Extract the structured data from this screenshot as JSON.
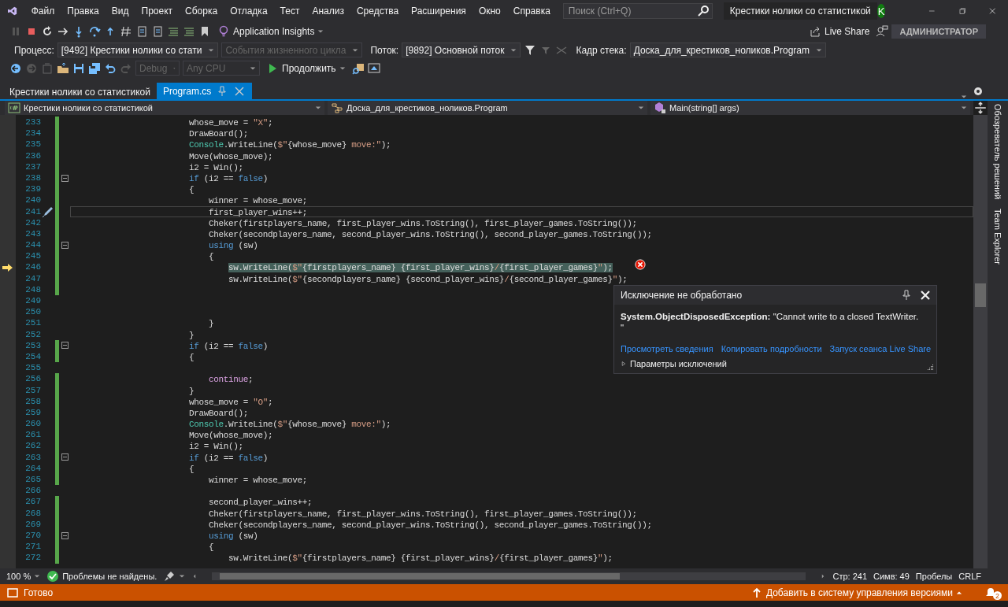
{
  "title_bar": {
    "menu": [
      "Файл",
      "Правка",
      "Вид",
      "Проект",
      "Сборка",
      "Отладка",
      "Тест",
      "Анализ",
      "Средства",
      "Расширения",
      "Окно",
      "Справка"
    ],
    "search": {
      "placeholder": "Поиск (Ctrl+Q)"
    },
    "solution_name": "Крестики нолики со статистикой",
    "avatar": "K"
  },
  "toolbar": {
    "application_insights": "Application Insights",
    "live_share": "Live Share",
    "user_badge": "АДМИНИСТРАТОР"
  },
  "debug_location": [
    {
      "kind": "label",
      "text": "Процесс:"
    },
    {
      "kind": "dropdown",
      "text": "[9492] Крестики нолики со стати",
      "disabled": false
    },
    {
      "kind": "dropdown",
      "text": "События жизненного цикла",
      "disabled": true
    },
    {
      "kind": "label",
      "text": "Поток:"
    },
    {
      "kind": "dropdown",
      "text": "[9892] Основной поток",
      "disabled": false
    },
    {
      "kind": "label",
      "text": "Кадр стека:"
    },
    {
      "kind": "dropdown",
      "text": "Доска_для_крестиков_ноликов.Program",
      "disabled": false
    }
  ],
  "standard_toolbar": {
    "configs": [
      {
        "text": "Debug",
        "disabled": true
      },
      {
        "text": "Any CPU",
        "disabled": true
      }
    ],
    "continue_button": "Продолжить"
  },
  "tabs": [
    {
      "label": "Крестики нолики со статистикой",
      "selected": false
    },
    {
      "label": "Program.cs",
      "selected": true
    }
  ],
  "navigation": [
    "Крестики нолики со статистикой",
    "Доска_для_крестиков_ноликов.Program",
    "Main(string[] args)"
  ],
  "code_lines": [
    {
      "number": "233",
      "changed": true,
      "foldable": false,
      "cursor": false,
      "highlighted": false,
      "tokens": [
        {
          "kind": "p",
          "text": "                        whose_move = "
        },
        {
          "kind": "st",
          "text": "\"X\""
        },
        {
          "kind": "p",
          "text": ";"
        }
      ]
    },
    {
      "number": "234",
      "changed": true,
      "foldable": false,
      "cursor": false,
      "highlighted": false,
      "tokens": [
        {
          "kind": "p",
          "text": "                        DrawBoard();"
        }
      ]
    },
    {
      "number": "235",
      "changed": true,
      "foldable": false,
      "cursor": false,
      "highlighted": false,
      "tokens": [
        {
          "kind": "ty",
          "text": "                        Console"
        },
        {
          "kind": "p",
          "text": ".WriteLine("
        },
        {
          "kind": "st",
          "text": "$\""
        },
        {
          "kind": "p",
          "text": "{whose_move}"
        },
        {
          "kind": "st",
          "text": " move:\""
        },
        {
          "kind": "p",
          "text": ");"
        }
      ]
    },
    {
      "number": "236",
      "changed": true,
      "foldable": false,
      "cursor": false,
      "highlighted": false,
      "tokens": [
        {
          "kind": "p",
          "text": "                        Move(whose_move);"
        }
      ]
    },
    {
      "number": "237",
      "changed": true,
      "foldable": false,
      "cursor": false,
      "highlighted": false,
      "tokens": [
        {
          "kind": "p",
          "text": "                        i2 = Win();"
        }
      ]
    },
    {
      "number": "238",
      "changed": true,
      "foldable": true,
      "cursor": false,
      "highlighted": false,
      "tokens": [
        {
          "kind": "kw",
          "text": "                        if"
        },
        {
          "kind": "p",
          "text": " (i2 == "
        },
        {
          "kind": "kw",
          "text": "false"
        },
        {
          "kind": "p",
          "text": ")"
        }
      ]
    },
    {
      "number": "239",
      "changed": true,
      "foldable": false,
      "cursor": false,
      "highlighted": false,
      "tokens": [
        {
          "kind": "p",
          "text": "                        {"
        }
      ]
    },
    {
      "number": "240",
      "changed": true,
      "foldable": false,
      "cursor": false,
      "highlighted": false,
      "tokens": [
        {
          "kind": "p",
          "text": "                            winner = whose_move;"
        }
      ]
    },
    {
      "number": "241",
      "changed": true,
      "foldable": false,
      "cursor": true,
      "highlighted": false,
      "tokens": [
        {
          "kind": "p",
          "text": "                            first_player_wins++;"
        }
      ]
    },
    {
      "number": "242",
      "changed": true,
      "foldable": false,
      "cursor": false,
      "highlighted": false,
      "tokens": [
        {
          "kind": "p",
          "text": "                            Cheker(firstplayers_name, first_player_wins.ToString(), first_player_games.ToString());"
        }
      ]
    },
    {
      "number": "243",
      "changed": true,
      "foldable": false,
      "cursor": false,
      "highlighted": false,
      "tokens": [
        {
          "kind": "p",
          "text": "                            Cheker(secondplayers_name, second_player_wins.ToString(), second_player_games.ToString());"
        }
      ]
    },
    {
      "number": "244",
      "changed": true,
      "foldable": true,
      "cursor": false,
      "highlighted": false,
      "tokens": [
        {
          "kind": "kw",
          "text": "                            using"
        },
        {
          "kind": "p",
          "text": " (sw)"
        }
      ]
    },
    {
      "number": "245",
      "changed": true,
      "foldable": false,
      "cursor": false,
      "highlighted": false,
      "tokens": [
        {
          "kind": "p",
          "text": "                            {"
        }
      ]
    },
    {
      "number": "246",
      "changed": true,
      "foldable": false,
      "cursor": false,
      "highlighted": true,
      "tokens": [
        {
          "kind": "p",
          "text": "                                sw.WriteLine("
        },
        {
          "kind": "st",
          "text": "$\""
        },
        {
          "kind": "p",
          "text": "{firstplayers_name} {first_player_wins}"
        },
        {
          "kind": "st",
          "text": "/"
        },
        {
          "kind": "p",
          "text": "{first_player_games}"
        },
        {
          "kind": "st",
          "text": "\""
        },
        {
          "kind": "p",
          "text": ");"
        }
      ]
    },
    {
      "number": "247",
      "changed": true,
      "foldable": false,
      "cursor": false,
      "highlighted": false,
      "tokens": [
        {
          "kind": "p",
          "text": "                                sw.WriteLine("
        },
        {
          "kind": "st",
          "text": "$\""
        },
        {
          "kind": "p",
          "text": "{secondplayers_name} {second_player_wins}"
        },
        {
          "kind": "st",
          "text": "/"
        },
        {
          "kind": "p",
          "text": "{second_player_games}"
        },
        {
          "kind": "st",
          "text": "\""
        },
        {
          "kind": "p",
          "text": ");"
        }
      ]
    },
    {
      "number": "248",
      "changed": true,
      "foldable": false,
      "cursor": false,
      "highlighted": false
    },
    {
      "number": "249",
      "changed": false,
      "foldable": false,
      "cursor": false,
      "highlighted": false
    },
    {
      "number": "250",
      "changed": false,
      "foldable": false,
      "cursor": false,
      "highlighted": false
    },
    {
      "number": "251",
      "changed": false,
      "foldable": false,
      "cursor": false,
      "highlighted": false,
      "tokens": [
        {
          "kind": "p",
          "text": "                            }"
        }
      ]
    },
    {
      "number": "252",
      "changed": false,
      "foldable": false,
      "cursor": false,
      "highlighted": false,
      "tokens": [
        {
          "kind": "p",
          "text": "                        }"
        }
      ]
    },
    {
      "number": "253",
      "changed": true,
      "foldable": true,
      "cursor": false,
      "highlighted": false,
      "tokens": [
        {
          "kind": "kw",
          "text": "                        if"
        },
        {
          "kind": "p",
          "text": " (i2 == "
        },
        {
          "kind": "kw",
          "text": "false"
        },
        {
          "kind": "p",
          "text": ")"
        }
      ]
    },
    {
      "number": "254",
      "changed": true,
      "foldable": false,
      "cursor": false,
      "highlighted": false,
      "tokens": [
        {
          "kind": "p",
          "text": "                        {"
        }
      ]
    },
    {
      "number": "255",
      "changed": false,
      "foldable": false,
      "cursor": false,
      "highlighted": false
    },
    {
      "number": "256",
      "changed": true,
      "foldable": false,
      "cursor": false,
      "highlighted": false,
      "tokens": [
        {
          "kind": "ct",
          "text": "                            continue"
        },
        {
          "kind": "p",
          "text": ";"
        }
      ]
    },
    {
      "number": "257",
      "changed": true,
      "foldable": false,
      "cursor": false,
      "highlighted": false,
      "tokens": [
        {
          "kind": "p",
          "text": "                        }"
        }
      ]
    },
    {
      "number": "258",
      "changed": true,
      "foldable": false,
      "cursor": false,
      "highlighted": false,
      "tokens": [
        {
          "kind": "p",
          "text": "                        whose_move = "
        },
        {
          "kind": "st",
          "text": "\"O\""
        },
        {
          "kind": "p",
          "text": ";"
        }
      ]
    },
    {
      "number": "259",
      "changed": true,
      "foldable": false,
      "cursor": false,
      "highlighted": false,
      "tokens": [
        {
          "kind": "p",
          "text": "                        DrawBoard();"
        }
      ]
    },
    {
      "number": "260",
      "changed": true,
      "foldable": false,
      "cursor": false,
      "highlighted": false,
      "tokens": [
        {
          "kind": "ty",
          "text": "                        Console"
        },
        {
          "kind": "p",
          "text": ".WriteLine("
        },
        {
          "kind": "st",
          "text": "$\""
        },
        {
          "kind": "p",
          "text": "{whose_move}"
        },
        {
          "kind": "st",
          "text": " move:\""
        },
        {
          "kind": "p",
          "text": ");"
        }
      ]
    },
    {
      "number": "261",
      "changed": true,
      "foldable": false,
      "cursor": false,
      "highlighted": false,
      "tokens": [
        {
          "kind": "p",
          "text": "                        Move(whose_move);"
        }
      ]
    },
    {
      "number": "262",
      "changed": true,
      "foldable": false,
      "cursor": false,
      "highlighted": false,
      "tokens": [
        {
          "kind": "p",
          "text": "                        i2 = Win();"
        }
      ]
    },
    {
      "number": "263",
      "changed": true,
      "foldable": true,
      "cursor": false,
      "highlighted": false,
      "tokens": [
        {
          "kind": "kw",
          "text": "                        if"
        },
        {
          "kind": "p",
          "text": " (i2 == "
        },
        {
          "kind": "kw",
          "text": "false"
        },
        {
          "kind": "p",
          "text": ")"
        }
      ]
    },
    {
      "number": "264",
      "changed": true,
      "foldable": false,
      "cursor": false,
      "highlighted": false,
      "tokens": [
        {
          "kind": "p",
          "text": "                        {"
        }
      ]
    },
    {
      "number": "265",
      "changed": true,
      "foldable": false,
      "cursor": false,
      "highlighted": false,
      "tokens": [
        {
          "kind": "p",
          "text": "                            winner = whose_move;"
        }
      ]
    },
    {
      "number": "266",
      "changed": false,
      "foldable": false,
      "cursor": false,
      "highlighted": false
    },
    {
      "number": "267",
      "changed": true,
      "foldable": false,
      "cursor": false,
      "highlighted": false,
      "tokens": [
        {
          "kind": "p",
          "text": "                            second_player_wins++;"
        }
      ]
    },
    {
      "number": "268",
      "changed": true,
      "foldable": false,
      "cursor": false,
      "highlighted": false,
      "tokens": [
        {
          "kind": "p",
          "text": "                            Cheker(firstplayers_name, first_player_wins.ToString(), first_player_games.ToString());"
        }
      ]
    },
    {
      "number": "269",
      "changed": true,
      "foldable": false,
      "cursor": false,
      "highlighted": false,
      "tokens": [
        {
          "kind": "p",
          "text": "                            Cheker(secondplayers_name, second_player_wins.ToString(), second_player_games.ToString());"
        }
      ]
    },
    {
      "number": "270",
      "changed": true,
      "foldable": true,
      "cursor": false,
      "highlighted": false,
      "tokens": [
        {
          "kind": "kw",
          "text": "                            using"
        },
        {
          "kind": "p",
          "text": " (sw)"
        }
      ]
    },
    {
      "number": "271",
      "changed": true,
      "foldable": false,
      "cursor": false,
      "highlighted": false,
      "tokens": [
        {
          "kind": "p",
          "text": "                            {"
        }
      ]
    },
    {
      "number": "272",
      "changed": true,
      "foldable": false,
      "cursor": false,
      "highlighted": false,
      "tokens": [
        {
          "kind": "p",
          "text": "                                sw.WriteLine("
        },
        {
          "kind": "st",
          "text": "$\""
        },
        {
          "kind": "p",
          "text": "{firstplayers_name} {first_player_wins}"
        },
        {
          "kind": "st",
          "text": "/"
        },
        {
          "kind": "p",
          "text": "{first_player_games}"
        },
        {
          "kind": "st",
          "text": "\""
        },
        {
          "kind": "p",
          "text": ");"
        }
      ]
    }
  ],
  "exception": {
    "title": "Исключение не обработано",
    "message": "**System.ObjectDisposedException:** \"Cannot write to a closed TextWriter.\n\"",
    "links": [
      "Просмотреть сведения",
      "Копировать подробности",
      "Запуск сеанса Live Share"
    ],
    "settings": {
      "label": "Параметры исключений",
      "expanded": false
    }
  },
  "side_tabs": [
    "Обозреватель решений",
    "Team Explorer"
  ],
  "editor_status": {
    "zoom": "100 %",
    "issues": "Проблемы не найдены.",
    "line": "Стр: 241",
    "column": "Симв: 49",
    "indentation": "Пробелы",
    "line_endings": "CRLF"
  },
  "status_bar": {
    "text": "Готово",
    "source_control": "Добавить в систему управления версиями",
    "notifications": "2"
  }
}
